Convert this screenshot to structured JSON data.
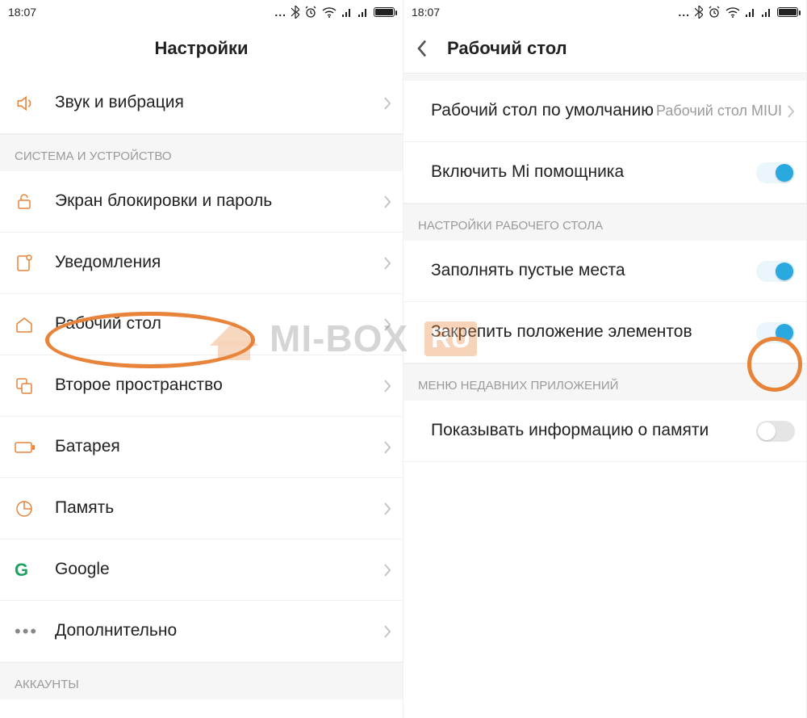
{
  "status": {
    "time": "18:07"
  },
  "left": {
    "title": "Настройки",
    "top_row": "Звук и вибрация",
    "section1": "СИСТЕМА И УСТРОЙСТВО",
    "items": [
      "Экран блокировки и пароль",
      "Уведомления",
      "Рабочий стол",
      "Второе пространство",
      "Батарея",
      "Память",
      "Google",
      "Дополнительно"
    ],
    "section2": "АККАУНТЫ"
  },
  "right": {
    "title": "Рабочий стол",
    "default_launcher_label": "Рабочий стол по умолчанию",
    "default_launcher_value": "Рабочий стол MIUI",
    "mi_assistant": "Включить Mi помощника",
    "section_desktop": "НАСТРОЙКИ РАБОЧЕГО СТОЛА",
    "fill_empty": "Заполнять пустые места",
    "lock_positions": "Закрепить положение элементов",
    "section_recent": "МЕНЮ НЕДАВНИХ ПРИЛОЖЕНИЙ",
    "show_memory": "Показывать информацию о памяти"
  },
  "watermark": {
    "text": "MI-BOX",
    "suffix": "RU"
  }
}
